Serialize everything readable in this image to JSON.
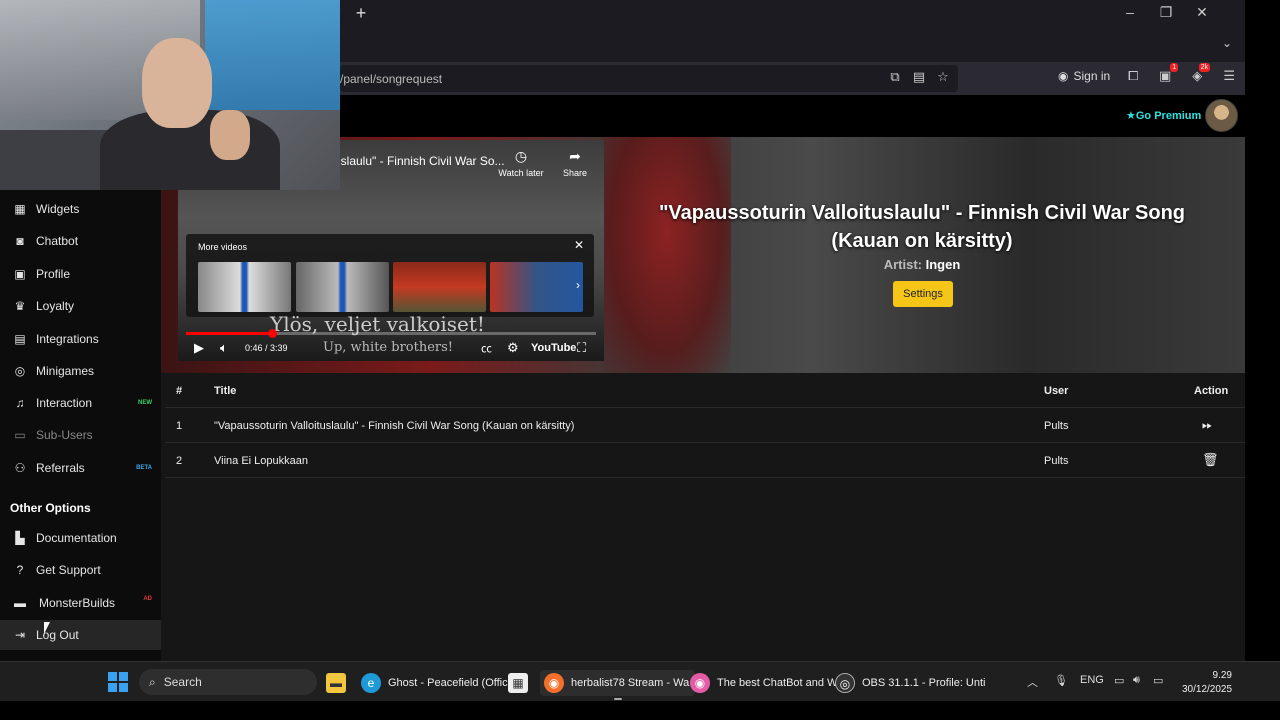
{
  "browser": {
    "url": "/panel/songrequest",
    "sign_in": "Sign in",
    "ext_badge_1": "1",
    "ext_badge_2": "2k"
  },
  "header": {
    "go_premium": "Go Premium"
  },
  "sidebar": {
    "items": [
      {
        "label": "Widgets",
        "icon": "widgets-icon"
      },
      {
        "label": "Chatbot",
        "icon": "robot-icon"
      },
      {
        "label": "Profile",
        "icon": "profile-card-icon"
      },
      {
        "label": "Loyalty",
        "icon": "trophy-icon"
      },
      {
        "label": "Integrations",
        "icon": "integrations-icon"
      },
      {
        "label": "Minigames",
        "icon": "gamepad-icon"
      },
      {
        "label": "Interaction",
        "icon": "music-note-icon",
        "tag": "NEW"
      },
      {
        "label": "Sub-Users",
        "icon": "sub-users-icon"
      },
      {
        "label": "Referrals",
        "icon": "users-icon",
        "tag": "BETA"
      }
    ],
    "other_options_title": "Other Options",
    "other_items": [
      {
        "label": "Documentation",
        "icon": "book-icon"
      },
      {
        "label": "Get Support",
        "icon": "question-icon"
      },
      {
        "label": "MonsterBuilds",
        "icon": "laptop-icon",
        "tag": "AD"
      },
      {
        "label": "Log Out",
        "icon": "logout-icon"
      }
    ]
  },
  "player": {
    "title": "lslaulu\" - Finnish Civil War So...",
    "watch_later": "Watch later",
    "share": "Share",
    "more_videos": "More videos",
    "subtitle_line1": "Ylös, veljet valkoiset!",
    "subtitle_line2": "Up, white brothers!",
    "time": "0:46 / 3:39",
    "progress_fraction": 0.21,
    "brand": "YouTube"
  },
  "now_playing": {
    "title": "\"Vapaussoturin Valloituslaulu\" - Finnish Civil War Song (Kauan on kärsitty)",
    "artist_label": "Artist:",
    "artist": "Ingen",
    "settings_label": "Settings"
  },
  "queue": {
    "headers": {
      "num": "#",
      "title": "Title",
      "user": "User",
      "action": "Action"
    },
    "rows": [
      {
        "num": "1",
        "title": "\"Vapaussoturin Valloituslaulu\" - Finnish Civil War Song (Kauan on kärsitty)",
        "user": "Pults",
        "action_icon": "skip-forward-icon"
      },
      {
        "num": "2",
        "title": "Viina Ei Lopukkaan",
        "user": "Pults",
        "action_icon": "trash-icon"
      }
    ]
  },
  "taskbar": {
    "search": "Search",
    "apps": [
      {
        "label": "Ghost - Peacefield (Offic",
        "icon": "edge-icon"
      },
      {
        "label": "herbalist78 Stream - Wa",
        "icon": "firefox-icon"
      },
      {
        "label": "The best ChatBot and W",
        "icon": "firefox-icon"
      },
      {
        "label": "OBS 31.1.1 - Profile: Unti",
        "icon": "obs-icon"
      }
    ],
    "lang": "ENG",
    "time": "9.29",
    "date": "30/12/2025"
  },
  "colors": {
    "accent_cyan": "#2ee0e0",
    "settings_yellow": "#f5c518",
    "tag_new": "#3ed26a",
    "tag_beta": "#3aa6e8",
    "progress_red": "#ff0000"
  }
}
